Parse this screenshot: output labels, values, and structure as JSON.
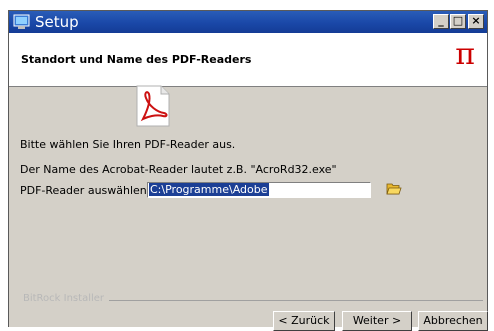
{
  "window": {
    "title": "Setup",
    "controls": {
      "minimize": "_",
      "maximize": "□",
      "close": "×"
    }
  },
  "header": {
    "title": "Standort und Name des PDF-Readers",
    "logo": "π"
  },
  "body": {
    "icon": "pdf-document-icon",
    "instruction": "Bitte wählen Sie Ihren PDF-Reader aus.",
    "hint": "Der Name des Acrobat-Reader lautet z.B.  \"AcroRd32.exe\"",
    "field_label": "PDF-Reader auswählen",
    "field_value": "C:\\Programme\\Adobe",
    "browse_icon": "folder-open-icon"
  },
  "footer": {
    "brand": "BitRock Installer",
    "back_label": "< Zurück",
    "next_label": "Weiter >",
    "cancel_label": "Abbrechen"
  },
  "colors": {
    "titlebar": "#1a48a8",
    "logo": "#cc0000",
    "selection": "#1c3f95",
    "dialog_bg": "#d4d0c8"
  }
}
